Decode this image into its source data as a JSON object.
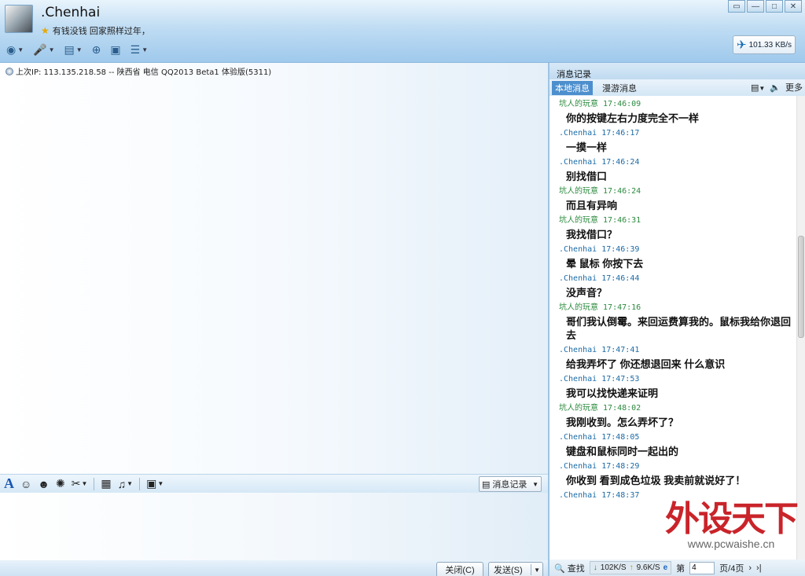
{
  "header": {
    "nickname": ".Chenhai",
    "signature": "有钱没钱 回家照样过年，",
    "speed": "101.33 KB/s"
  },
  "window_controls": [
    "restore-icon",
    "minimize-icon",
    "maximize-icon",
    "close-icon"
  ],
  "chat": {
    "last_ip": "上次IP: 113.135.218.58 -- 陕西省 电信 QQ2013 Beta1 体验版(5311)"
  },
  "input_toolbar": {
    "history_label": "消息记录"
  },
  "buttons": {
    "close": "关闭(C)",
    "send": "发送(S)"
  },
  "history_panel": {
    "title": "消息记录",
    "tabs": [
      "本地消息",
      "漫游消息"
    ],
    "more": "更多",
    "messages": [
      {
        "sender": "坑人的玩意",
        "time": "17:46:09",
        "text": "你的按键左右力度完全不一样",
        "role": "other"
      },
      {
        "sender": ".Chenhai",
        "time": "17:46:17",
        "text": "一摸一样",
        "role": "me"
      },
      {
        "sender": ".Chenhai",
        "time": "17:46:24",
        "text": "别找借口",
        "role": "me"
      },
      {
        "sender": "坑人的玩意",
        "time": "17:46:24",
        "text": "而且有异响",
        "role": "other"
      },
      {
        "sender": "坑人的玩意",
        "time": "17:46:31",
        "text": "我找借口？",
        "role": "other"
      },
      {
        "sender": ".Chenhai",
        "time": "17:46:39",
        "text": "晕 鼠标 你按下去",
        "role": "me"
      },
      {
        "sender": ".Chenhai",
        "time": "17:46:44",
        "text": "没声音？",
        "role": "me"
      },
      {
        "sender": "坑人的玩意",
        "time": "17:47:16",
        "text": "哥们我认倒霉。来回运费算我的。鼠标我给你退回去",
        "role": "other"
      },
      {
        "sender": ".Chenhai",
        "time": "17:47:41",
        "text": "给我弄坏了 你还想退回来 什么意识",
        "role": "me"
      },
      {
        "sender": ".Chenhai",
        "time": "17:47:53",
        "text": "我可以找快递来证明",
        "role": "me"
      },
      {
        "sender": "坑人的玩意",
        "time": "17:48:02",
        "text": "我刚收到。怎么弄坏了？",
        "role": "other"
      },
      {
        "sender": ".Chenhai",
        "time": "17:48:05",
        "text": "键盘和鼠标同时一起出的",
        "role": "me"
      },
      {
        "sender": ".Chenhai",
        "time": "17:48:29",
        "text": "你收到 看到成色垃圾 我卖前就说好了！",
        "role": "me"
      },
      {
        "sender": ".Chenhai",
        "time": "17:48:37",
        "text": "",
        "role": "me"
      }
    ],
    "search_label": "查找",
    "download_speed": "102K/S",
    "upload_speed": "9.6K/S",
    "page_prefix": "第",
    "page_value": "4",
    "page_suffix": "页/4页"
  },
  "watermark": {
    "brand": "外设天下",
    "url": "www.pcwaishe.cn"
  }
}
